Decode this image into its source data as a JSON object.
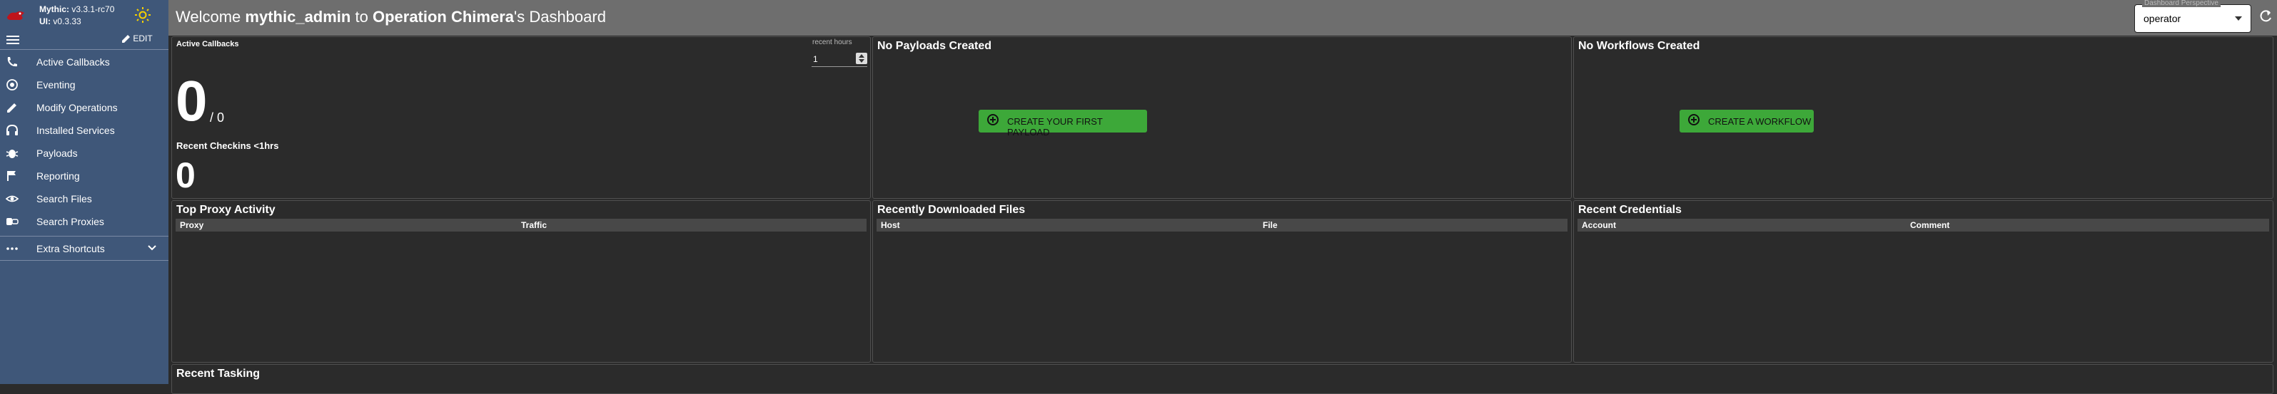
{
  "sidebar": {
    "mythic_label": "Mythic:",
    "mythic_version": "v3.3.1-rc70",
    "ui_label": "UI:",
    "ui_version": "v0.3.33",
    "edit_label": "EDIT",
    "items": [
      {
        "label": "Active Callbacks",
        "icon": "phone-icon"
      },
      {
        "label": "Eventing",
        "icon": "eventing-icon"
      },
      {
        "label": "Modify Operations",
        "icon": "pencil-icon"
      },
      {
        "label": "Installed Services",
        "icon": "headphones-icon"
      },
      {
        "label": "Payloads",
        "icon": "bug-icon"
      },
      {
        "label": "Reporting",
        "icon": "flag-icon"
      },
      {
        "label": "Search Files",
        "icon": "eye-icon"
      },
      {
        "label": "Search Proxies",
        "icon": "proxy-icon"
      }
    ],
    "extra_shortcuts": "Extra Shortcuts"
  },
  "header": {
    "welcome": "Welcome",
    "user": "mythic_admin",
    "to": "to",
    "operation": "Operation Chimera",
    "suffix": "'s Dashboard",
    "perspective_label": "Dashboard Perspective",
    "perspective_value": "operator"
  },
  "active_callbacks": {
    "title": "Active Callbacks",
    "hours_label": "recent hours",
    "hours_value": "1",
    "active_count": "0",
    "total": "/ 0",
    "checkins_title": "Recent Checkins <1hrs",
    "checkins_count": "0"
  },
  "payloads": {
    "title": "No Payloads Created",
    "button": "CREATE YOUR FIRST PAYLOAD"
  },
  "workflows": {
    "title": "No Workflows Created",
    "button": "CREATE A WORKFLOW"
  },
  "proxy": {
    "title": "Top Proxy Activity",
    "columns": [
      "Proxy",
      "Traffic"
    ]
  },
  "downloads": {
    "title": "Recently Downloaded Files",
    "columns": [
      "Host",
      "File"
    ]
  },
  "credentials": {
    "title": "Recent Credentials",
    "columns": [
      "Account",
      "Comment"
    ]
  },
  "tasking": {
    "title": "Recent Tasking"
  },
  "colors": {
    "sidebar_bg": "#3f5779",
    "header_bg": "#6e6e6e",
    "panel_bg": "#2b2b2b",
    "green_button": "#3da839"
  }
}
